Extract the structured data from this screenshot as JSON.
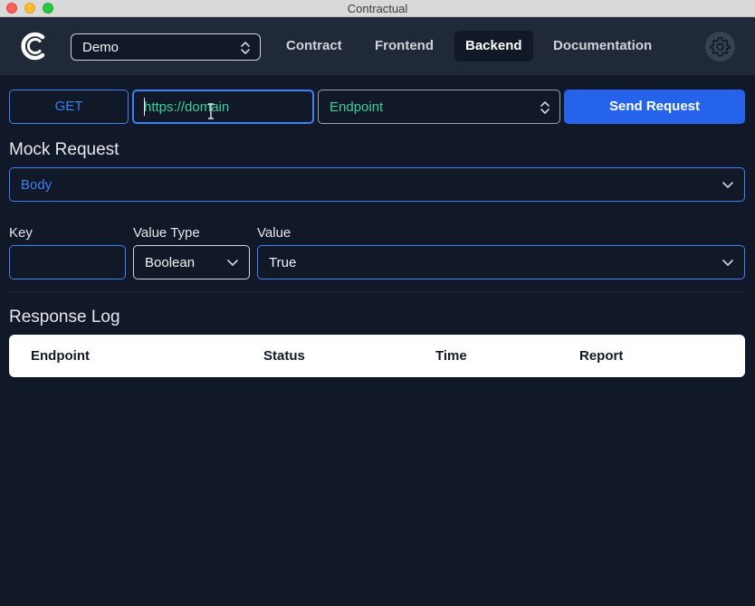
{
  "window": {
    "title": "Contractual"
  },
  "navbar": {
    "logo_icon": "contractual-logo-icon",
    "project_select": {
      "value": "Demo"
    },
    "tabs": [
      {
        "label": "Contract",
        "active": false
      },
      {
        "label": "Frontend",
        "active": false
      },
      {
        "label": "Backend",
        "active": true
      },
      {
        "label": "Documentation",
        "active": false
      }
    ],
    "settings_icon": "gear-icon"
  },
  "request_bar": {
    "method": "GET",
    "url_value": "https://domain",
    "endpoint_select": {
      "value": "Endpoint"
    },
    "send_label": "Send Request"
  },
  "mock_request": {
    "title": "Mock Request",
    "section_select": {
      "value": "Body"
    },
    "key_label": "Key",
    "key_value": "",
    "value_type_label": "Value Type",
    "value_type": "Boolean",
    "value_label": "Value",
    "value": "True"
  },
  "response_log": {
    "title": "Response Log",
    "columns": [
      "Endpoint",
      "Status",
      "Time",
      "Report"
    ],
    "rows": []
  },
  "colors": {
    "background": "#111827",
    "navbar": "#1f2937",
    "accent": "#3b82f6",
    "primary_button": "#2563eb",
    "url_text": "#34d399"
  }
}
